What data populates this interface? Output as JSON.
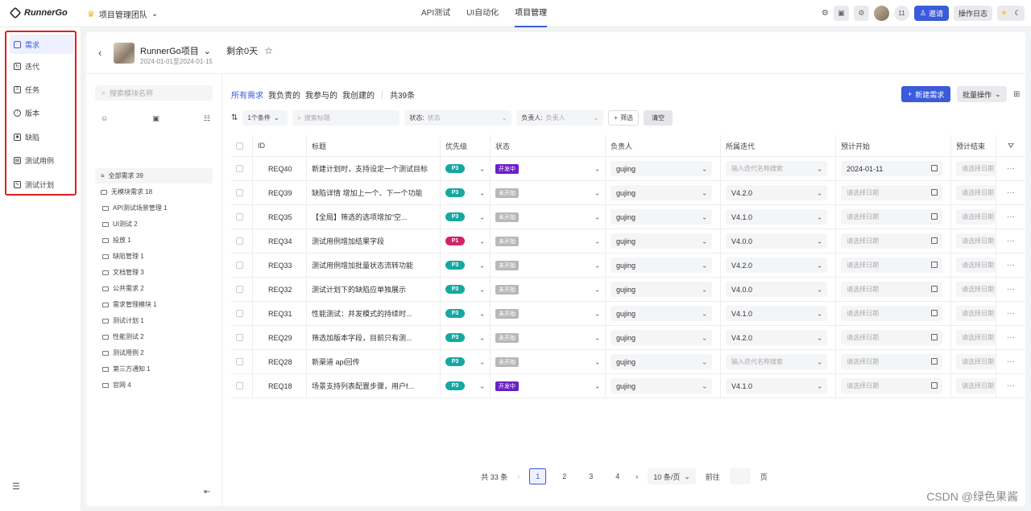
{
  "app": {
    "logo_text": "RunnerGo",
    "team_name": "项目管理团队"
  },
  "nav": [
    "API测试",
    "UI自动化",
    "项目管理"
  ],
  "nav_active": "项目管理",
  "top_right": {
    "member_count": "11",
    "invite_label": "邀请",
    "log_label": "操作日志"
  },
  "sidebar": {
    "items": [
      {
        "label": "需求",
        "icon": "comment-icon"
      },
      {
        "label": "迭代",
        "icon": "iteration-icon"
      },
      {
        "label": "任务",
        "icon": "task-icon"
      },
      {
        "label": "版本",
        "icon": "version-icon"
      },
      {
        "label": "缺陷",
        "icon": "bug-icon"
      },
      {
        "label": "测试用例",
        "icon": "testcase-icon"
      },
      {
        "label": "测试计划",
        "icon": "testplan-icon"
      }
    ]
  },
  "project": {
    "name": "RunnerGo项目",
    "dates": "2024-01-01至2024-01-15",
    "remaining": "剩余0天"
  },
  "tree": {
    "search_placeholder": "搜索模块名称",
    "root": "全部需求 39",
    "no_module": "无模块需求 18",
    "children": [
      "API测试场景管理 1",
      "UI测试 2",
      "投放 1",
      "缺陷管理 1",
      "文档管理 3",
      "公共需求 2",
      "需求管理模块 1",
      "测试计划 1",
      "性能测试 2",
      "测试用例 2",
      "第三方通知 1",
      "官网 4"
    ]
  },
  "tabs": {
    "items": [
      "所有需求",
      "我负责的",
      "我参与的",
      "我创建的"
    ],
    "total": "共39条"
  },
  "actions": {
    "new_label": "新建需求",
    "batch_label": "批量操作"
  },
  "filters": {
    "conditions": "1个条件",
    "search_placeholder": "搜索标题",
    "status_label": "状态:",
    "status_placeholder": "状态",
    "owner_label": "负责人:",
    "owner_placeholder": "负责人",
    "filter_label": "筛选",
    "clear_label": "清空"
  },
  "columns": [
    "ID",
    "标题",
    "优先级",
    "状态",
    "负责人",
    "所属迭代",
    "预计开始",
    "预计结束"
  ],
  "rows": [
    {
      "id": "REQ40",
      "title": "新建计划时，支持设定一个测试目标",
      "priority": "P3",
      "status": "开发中",
      "owner": "gujing",
      "iteration": "输入迭代名称搜索",
      "start": "2024-01-11",
      "end": "请选择日期"
    },
    {
      "id": "REQ39",
      "title": "缺陷详情 增加上一个、下一个功能",
      "priority": "P3",
      "status": "未开始",
      "owner": "gujing",
      "iteration": "V4.2.0",
      "start": "请选择日期",
      "end": "请选择日期"
    },
    {
      "id": "REQ35",
      "title": "【全局】筛选的选项增加“空...",
      "priority": "P3",
      "status": "未开始",
      "owner": "gujing",
      "iteration": "V4.1.0",
      "start": "请选择日期",
      "end": "请选择日期"
    },
    {
      "id": "REQ34",
      "title": "测试用例增加结果字段",
      "priority": "P1",
      "status": "未开始",
      "owner": "gujing",
      "iteration": "V4.0.0",
      "start": "请选择日期",
      "end": "请选择日期"
    },
    {
      "id": "REQ33",
      "title": "测试用例增加批量状态流转功能",
      "priority": "P3",
      "status": "未开始",
      "owner": "gujing",
      "iteration": "V4.2.0",
      "start": "请选择日期",
      "end": "请选择日期"
    },
    {
      "id": "REQ32",
      "title": "测试计划下的缺陷应单独展示",
      "priority": "P3",
      "status": "未开始",
      "owner": "gujing",
      "iteration": "V4.0.0",
      "start": "请选择日期",
      "end": "请选择日期"
    },
    {
      "id": "REQ31",
      "title": "性能测试：并发模式的持续时...",
      "priority": "P3",
      "status": "未开始",
      "owner": "gujing",
      "iteration": "V4.1.0",
      "start": "请选择日期",
      "end": "请选择日期"
    },
    {
      "id": "REQ29",
      "title": "筛选加版本字段，目前只有测...",
      "priority": "P3",
      "status": "未开始",
      "owner": "gujing",
      "iteration": "V4.2.0",
      "start": "请选择日期",
      "end": "请选择日期"
    },
    {
      "id": "REQ28",
      "title": "新渠道 api回传",
      "priority": "P3",
      "status": "未开始",
      "owner": "gujing",
      "iteration": "输入迭代名称搜索",
      "start": "请选择日期",
      "end": "请选择日期"
    },
    {
      "id": "REQ18",
      "title": "场景支持列表配置步骤，用户f...",
      "priority": "P3",
      "status": "开发中",
      "owner": "gujing",
      "iteration": "V4.1.0",
      "start": "请选择日期",
      "end": "请选择日期"
    }
  ],
  "colors": {
    "accent": "#3b5bdb",
    "p3": "#16a8a0",
    "p1": "#d6206b",
    "developing": "#6a1fc7",
    "not_started": "#b8b8b8",
    "highlight_box": "#e02020"
  },
  "pager": {
    "total": "共 33 条",
    "pages": [
      "1",
      "2",
      "3",
      "4"
    ],
    "current": "1",
    "page_size": "10 条/页",
    "goto_label": "前往",
    "page_unit": "页"
  },
  "watermark": "CSDN @绿色果酱"
}
